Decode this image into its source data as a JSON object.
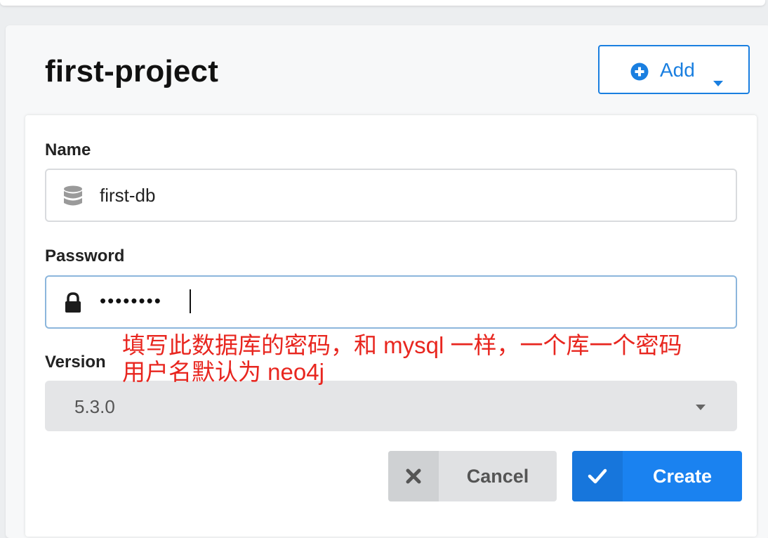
{
  "project": {
    "title": "first-project"
  },
  "add_menu": {
    "label": "Add",
    "icon": "plus-circle-icon",
    "caret_icon": "caret-down-icon"
  },
  "form": {
    "name": {
      "label": "Name",
      "value": "first-db",
      "icon": "database-icon"
    },
    "password": {
      "label": "Password",
      "masked_value": "••••••••",
      "icon": "lock-icon"
    },
    "version": {
      "label": "Version",
      "selected": "5.3.0",
      "caret_icon": "caret-down-icon"
    }
  },
  "annotation": {
    "line1": "填写此数据库的密码，和 mysql 一样，一个库一个密码",
    "line2": "用户名默认为 neo4j",
    "color": "#e8261f"
  },
  "actions": {
    "cancel_label": "Cancel",
    "cancel_icon": "x-icon",
    "create_label": "Create",
    "create_icon": "check-icon"
  },
  "colors": {
    "accent": "#1a82f0",
    "focus_border": "#8cb6dc"
  }
}
